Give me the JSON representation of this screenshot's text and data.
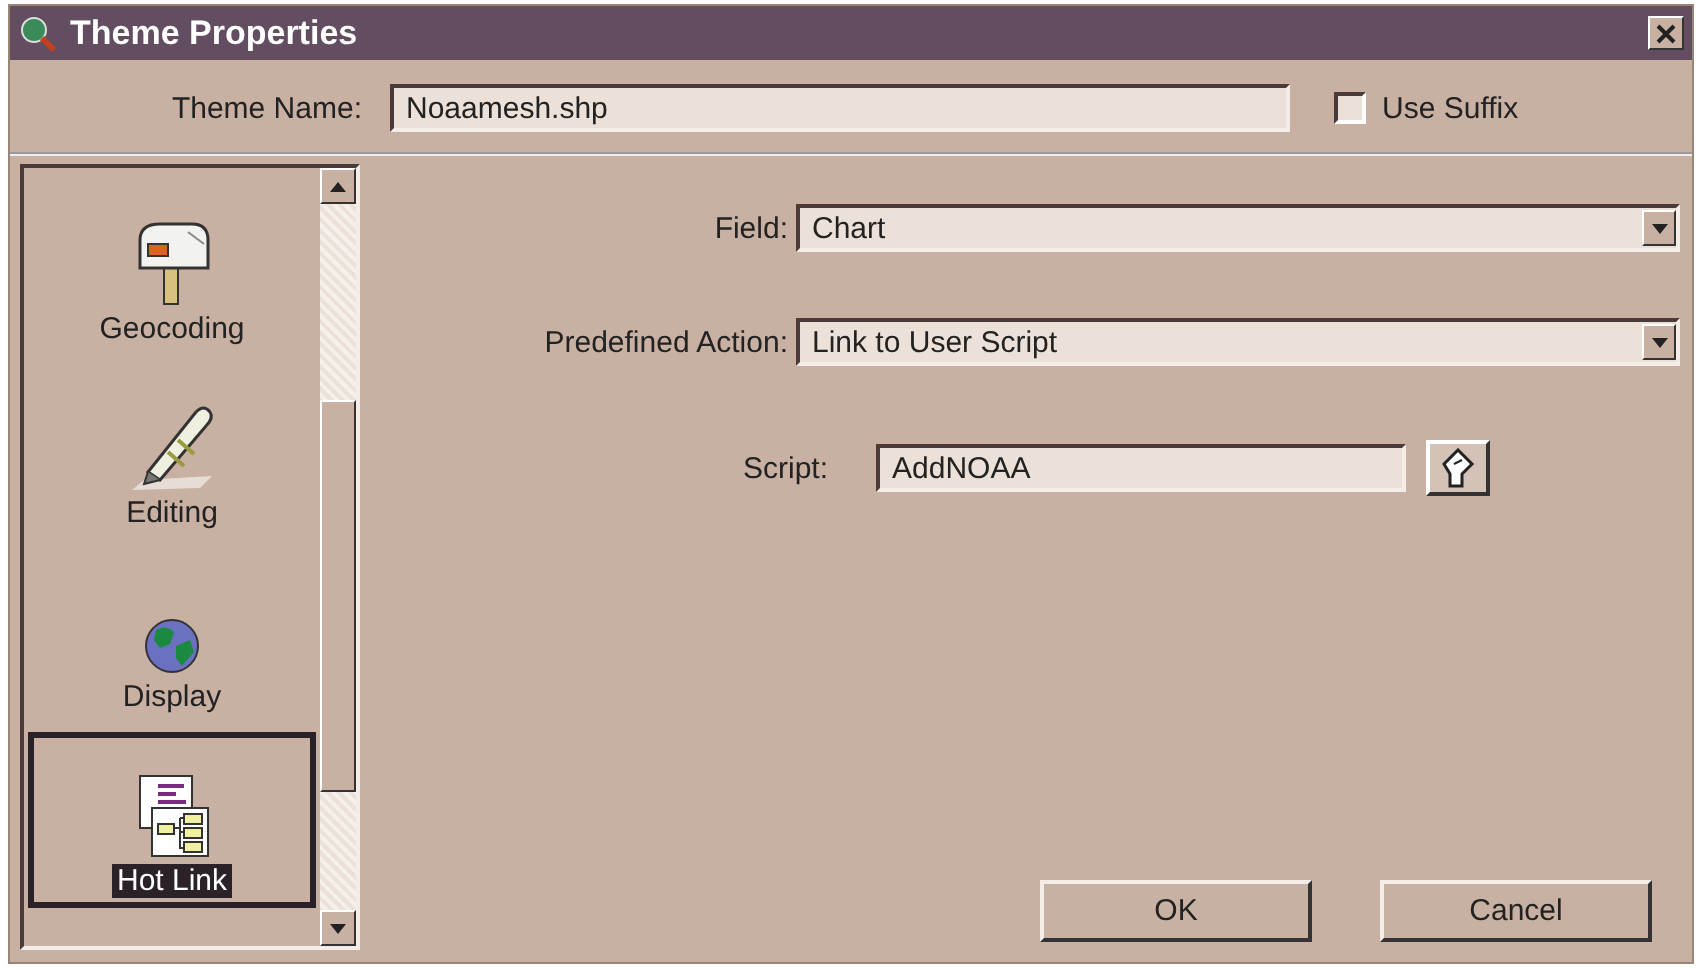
{
  "window": {
    "title": "Theme Properties"
  },
  "theme_name": {
    "label": "Theme Name:",
    "value": "Noaamesh.shp"
  },
  "use_suffix": {
    "label": "Use Suffix",
    "checked": false
  },
  "categories": [
    {
      "label": "Geocoding",
      "kind": "mailbox",
      "selected": false
    },
    {
      "label": "Editing",
      "kind": "pencil",
      "selected": false
    },
    {
      "label": "Display",
      "kind": "globe",
      "selected": false
    },
    {
      "label": "Hot Link",
      "kind": "hotlink",
      "selected": true
    }
  ],
  "field": {
    "label": "Field:",
    "value": "Chart"
  },
  "predefined_action": {
    "label": "Predefined Action:",
    "value": "Link to User Script"
  },
  "script": {
    "label": "Script:",
    "value": "AddNOAA"
  },
  "buttons": [
    "OK",
    "Cancel"
  ]
}
